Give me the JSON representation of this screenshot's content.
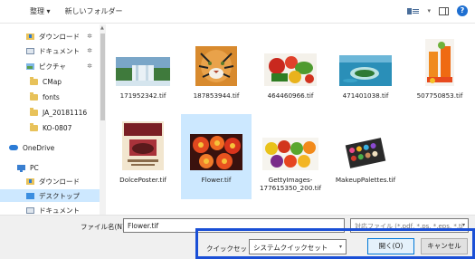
{
  "toolbar": {
    "organize": "整理 ▾",
    "new_folder": "新しいフォルダー"
  },
  "nav": {
    "items": [
      {
        "label": "ダウンロード",
        "icon": "download-folder-icon",
        "pinned": true
      },
      {
        "label": "ドキュメント",
        "icon": "documents-icon",
        "pinned": true
      },
      {
        "label": "ピクチャ",
        "icon": "pictures-icon",
        "pinned": true
      },
      {
        "label": "CMap",
        "icon": "folder-icon"
      },
      {
        "label": "fonts",
        "icon": "folder-icon"
      },
      {
        "label": "JA_20181116",
        "icon": "folder-icon"
      },
      {
        "label": "KO-0807",
        "icon": "folder-icon"
      },
      {
        "label": "OneDrive",
        "icon": "onedrive-cloud-icon"
      },
      {
        "label": "PC",
        "icon": "pc-icon"
      },
      {
        "label": "ダウンロード",
        "icon": "download-folder-icon"
      },
      {
        "label": "デスクトップ",
        "icon": "desktop-icon",
        "selected": true
      },
      {
        "label": "ドキュメント",
        "icon": "documents-icon"
      }
    ]
  },
  "files": [
    {
      "name": "171952342.tif",
      "thumb": "waterfall"
    },
    {
      "name": "187853944.tif",
      "thumb": "tiger"
    },
    {
      "name": "464460966.tif",
      "thumb": "vegetables"
    },
    {
      "name": "471401038.tif",
      "thumb": "island"
    },
    {
      "name": "507750853.tif",
      "thumb": "drinks"
    },
    {
      "name": "DolcePoster.tif",
      "thumb": "poster"
    },
    {
      "name": "Flower.tif",
      "thumb": "flowers",
      "selected": true
    },
    {
      "name": "GettyImages-177615350_200.tif",
      "thumb": "fruits"
    },
    {
      "name": "MakeupPalettes.tif",
      "thumb": "palette"
    }
  ],
  "bottom": {
    "filename_label": "ファイル名(N):",
    "filename_value": "Flower.tif",
    "filetype_value": "対応ファイル (*.pdf, *.ps, *.eps, *.ti",
    "quickset_label": "クイックセット:",
    "quickset_value": "システムクイックセット",
    "open_label": "開く(O)",
    "cancel_label": "キャンセル"
  },
  "colors": {
    "selection": "#cce8ff",
    "highlight_box": "#1a4fd6",
    "accent": "#0078d7"
  }
}
